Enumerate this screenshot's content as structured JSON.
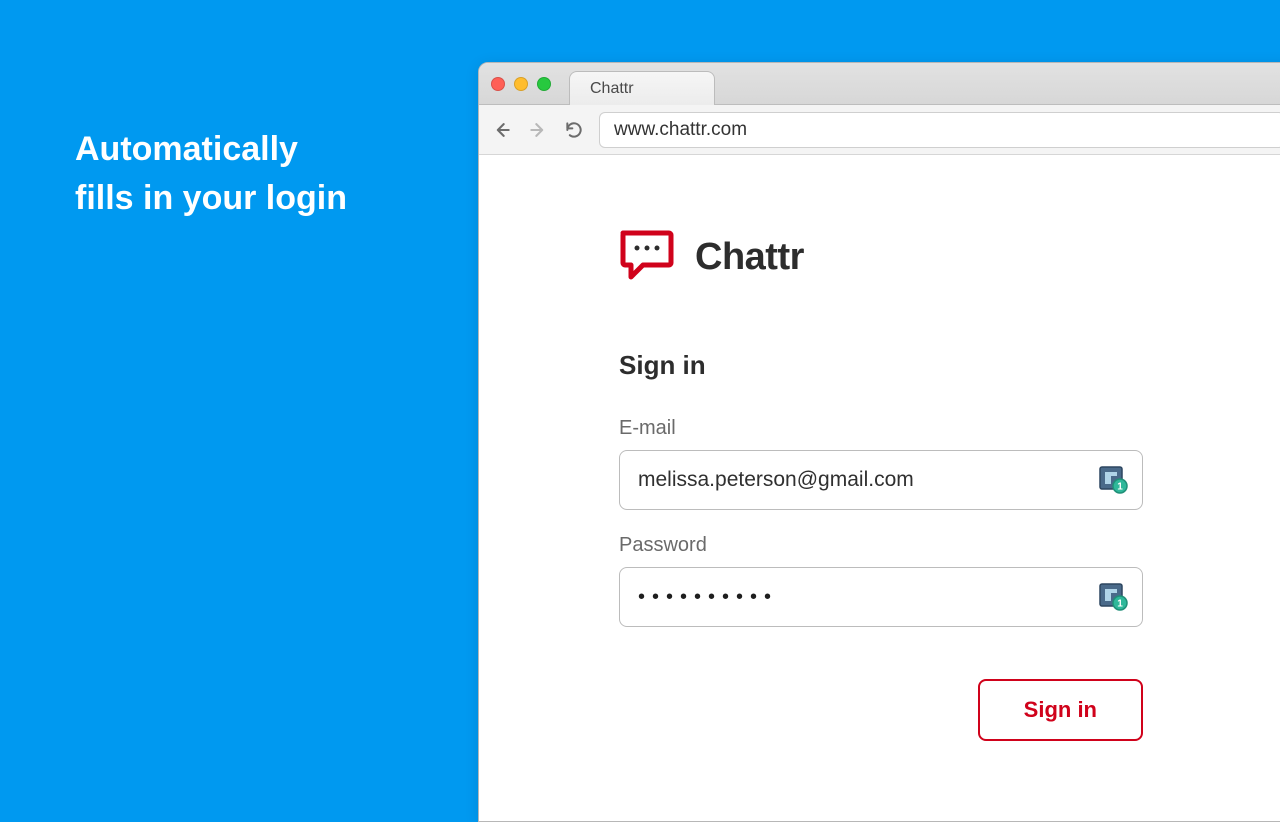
{
  "tagline": {
    "line1": "Automatically",
    "line2": "fills in your login"
  },
  "browser": {
    "tab_title": "Chattr",
    "url": "www.chattr.com"
  },
  "page": {
    "brand_name": "Chattr",
    "signin_title": "Sign in",
    "email_label": "E-mail",
    "email_value": "melissa.peterson@gmail.com",
    "password_label": "Password",
    "password_value_masked": "••••••••••",
    "signin_button": "Sign in"
  }
}
